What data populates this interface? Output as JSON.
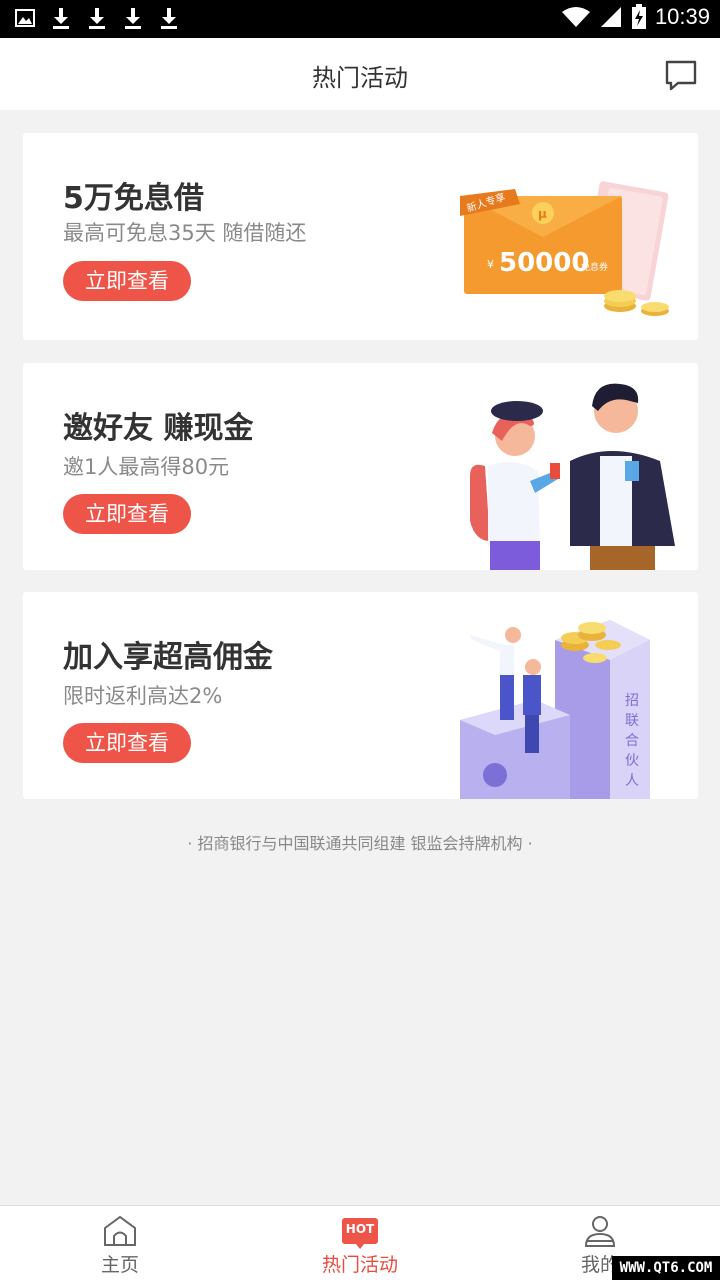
{
  "status_bar": {
    "time": "10:39",
    "left_icons": [
      "image-icon",
      "download-icon",
      "download-icon",
      "download-icon",
      "download-icon"
    ],
    "right_icons": [
      "wifi-icon",
      "signal-icon",
      "battery-icon"
    ]
  },
  "header": {
    "title": "热门活动",
    "message_icon": "message-icon"
  },
  "cards": [
    {
      "title": "5万免息借",
      "subtitle": "最高可免息35天 随借随还",
      "button": "立即查看",
      "art": {
        "ribbon": "新人专享",
        "amount": "50000",
        "currency": "¥",
        "tag": "免息券"
      }
    },
    {
      "title": "邀好友 赚现金",
      "subtitle": "邀1人最高得80元",
      "button": "立即查看"
    },
    {
      "title": "加入享超高佣金",
      "subtitle": "限时返利高达2%",
      "button": "立即查看",
      "art": {
        "vertical_text": [
          "招",
          "联",
          "合",
          "伙",
          "人"
        ]
      }
    }
  ],
  "footer_note": "· 招商银行与中国联通共同组建 银监会持牌机构 ·",
  "bottom_nav": {
    "items": [
      {
        "label": "主页",
        "icon": "home-icon"
      },
      {
        "label": "热门活动",
        "icon": "hot-icon",
        "badge": "HOT",
        "active": true
      },
      {
        "label": "我的",
        "icon": "user-icon"
      }
    ]
  },
  "watermark": "WWW.QT6.COM",
  "colors": {
    "accent": "#ee5448",
    "background": "#f2f2f2"
  }
}
